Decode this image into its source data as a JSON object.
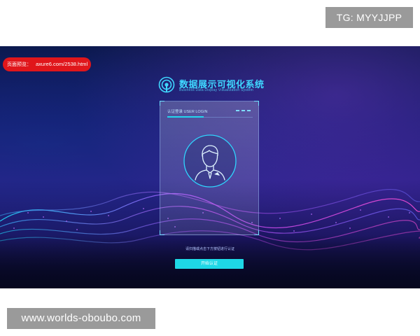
{
  "overlays": {
    "tg_badge": "TG: MYYJJPP",
    "site_watermark": "www.worlds-oboubo.com"
  },
  "preview": {
    "label": "页面预览：",
    "url": "axure6.com/2538.html",
    "color": "#e0161b"
  },
  "header": {
    "title": "数据展示可视化系统",
    "subtitle": "Business Data Display Visualization System",
    "logo_icon": "signal-tower-icon",
    "accent_color": "#3fd7ff"
  },
  "login_panel": {
    "heading": "认证登录 USER LOGIN",
    "avatar_icon": "user-avatar-icon",
    "hint": "请扫描或点击下方按钮进行认证",
    "button_label": "开始认证",
    "button_color": "#1ed8e6"
  }
}
